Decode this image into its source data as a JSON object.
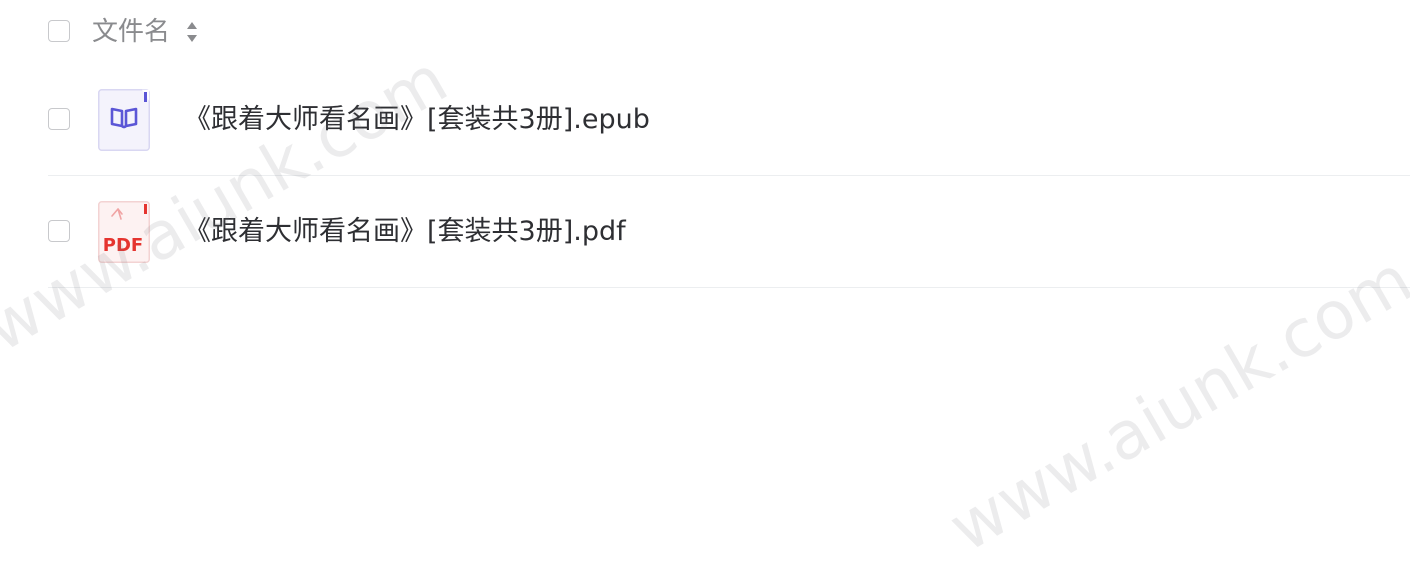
{
  "header": {
    "column_label": "文件名",
    "sort_icon": "sort-icon"
  },
  "files": [
    {
      "name": "《跟着大师看名画》[套装共3册].epub",
      "icon": "epub-book-icon",
      "icon_color": "#5b56d6"
    },
    {
      "name": "《跟着大师看名画》[套装共3册].pdf",
      "icon": "pdf-icon",
      "icon_color": "#e5342f",
      "icon_text": "PDF"
    }
  ],
  "watermark": {
    "text": "www.aiunk.com"
  }
}
